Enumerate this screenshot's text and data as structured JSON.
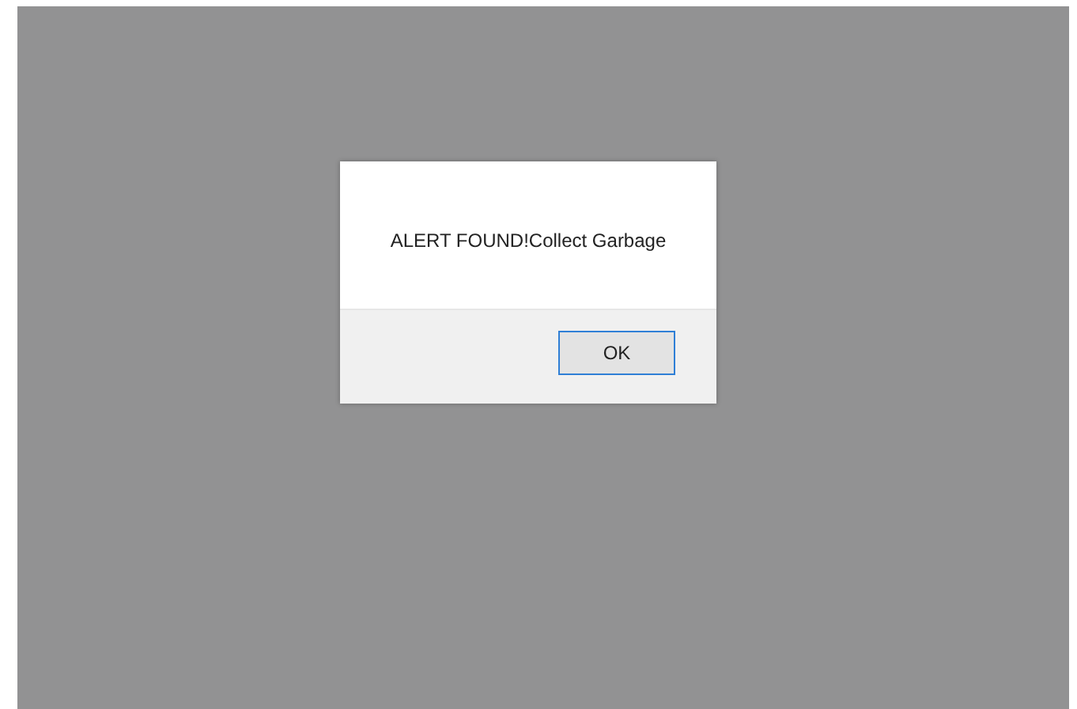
{
  "dialog": {
    "message": "ALERT FOUND!Collect Garbage",
    "buttons": [
      "OK"
    ]
  }
}
